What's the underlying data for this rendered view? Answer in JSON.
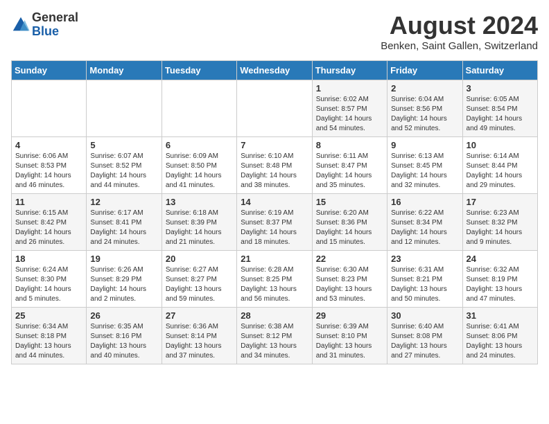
{
  "logo": {
    "general": "General",
    "blue": "Blue"
  },
  "title": {
    "month_year": "August 2024",
    "location": "Benken, Saint Gallen, Switzerland"
  },
  "weekdays": [
    "Sunday",
    "Monday",
    "Tuesday",
    "Wednesday",
    "Thursday",
    "Friday",
    "Saturday"
  ],
  "weeks": [
    [
      {
        "day": "",
        "detail": ""
      },
      {
        "day": "",
        "detail": ""
      },
      {
        "day": "",
        "detail": ""
      },
      {
        "day": "",
        "detail": ""
      },
      {
        "day": "1",
        "detail": "Sunrise: 6:02 AM\nSunset: 8:57 PM\nDaylight: 14 hours\nand 54 minutes."
      },
      {
        "day": "2",
        "detail": "Sunrise: 6:04 AM\nSunset: 8:56 PM\nDaylight: 14 hours\nand 52 minutes."
      },
      {
        "day": "3",
        "detail": "Sunrise: 6:05 AM\nSunset: 8:54 PM\nDaylight: 14 hours\nand 49 minutes."
      }
    ],
    [
      {
        "day": "4",
        "detail": "Sunrise: 6:06 AM\nSunset: 8:53 PM\nDaylight: 14 hours\nand 46 minutes."
      },
      {
        "day": "5",
        "detail": "Sunrise: 6:07 AM\nSunset: 8:52 PM\nDaylight: 14 hours\nand 44 minutes."
      },
      {
        "day": "6",
        "detail": "Sunrise: 6:09 AM\nSunset: 8:50 PM\nDaylight: 14 hours\nand 41 minutes."
      },
      {
        "day": "7",
        "detail": "Sunrise: 6:10 AM\nSunset: 8:48 PM\nDaylight: 14 hours\nand 38 minutes."
      },
      {
        "day": "8",
        "detail": "Sunrise: 6:11 AM\nSunset: 8:47 PM\nDaylight: 14 hours\nand 35 minutes."
      },
      {
        "day": "9",
        "detail": "Sunrise: 6:13 AM\nSunset: 8:45 PM\nDaylight: 14 hours\nand 32 minutes."
      },
      {
        "day": "10",
        "detail": "Sunrise: 6:14 AM\nSunset: 8:44 PM\nDaylight: 14 hours\nand 29 minutes."
      }
    ],
    [
      {
        "day": "11",
        "detail": "Sunrise: 6:15 AM\nSunset: 8:42 PM\nDaylight: 14 hours\nand 26 minutes."
      },
      {
        "day": "12",
        "detail": "Sunrise: 6:17 AM\nSunset: 8:41 PM\nDaylight: 14 hours\nand 24 minutes."
      },
      {
        "day": "13",
        "detail": "Sunrise: 6:18 AM\nSunset: 8:39 PM\nDaylight: 14 hours\nand 21 minutes."
      },
      {
        "day": "14",
        "detail": "Sunrise: 6:19 AM\nSunset: 8:37 PM\nDaylight: 14 hours\nand 18 minutes."
      },
      {
        "day": "15",
        "detail": "Sunrise: 6:20 AM\nSunset: 8:36 PM\nDaylight: 14 hours\nand 15 minutes."
      },
      {
        "day": "16",
        "detail": "Sunrise: 6:22 AM\nSunset: 8:34 PM\nDaylight: 14 hours\nand 12 minutes."
      },
      {
        "day": "17",
        "detail": "Sunrise: 6:23 AM\nSunset: 8:32 PM\nDaylight: 14 hours\nand 9 minutes."
      }
    ],
    [
      {
        "day": "18",
        "detail": "Sunrise: 6:24 AM\nSunset: 8:30 PM\nDaylight: 14 hours\nand 5 minutes."
      },
      {
        "day": "19",
        "detail": "Sunrise: 6:26 AM\nSunset: 8:29 PM\nDaylight: 14 hours\nand 2 minutes."
      },
      {
        "day": "20",
        "detail": "Sunrise: 6:27 AM\nSunset: 8:27 PM\nDaylight: 13 hours\nand 59 minutes."
      },
      {
        "day": "21",
        "detail": "Sunrise: 6:28 AM\nSunset: 8:25 PM\nDaylight: 13 hours\nand 56 minutes."
      },
      {
        "day": "22",
        "detail": "Sunrise: 6:30 AM\nSunset: 8:23 PM\nDaylight: 13 hours\nand 53 minutes."
      },
      {
        "day": "23",
        "detail": "Sunrise: 6:31 AM\nSunset: 8:21 PM\nDaylight: 13 hours\nand 50 minutes."
      },
      {
        "day": "24",
        "detail": "Sunrise: 6:32 AM\nSunset: 8:19 PM\nDaylight: 13 hours\nand 47 minutes."
      }
    ],
    [
      {
        "day": "25",
        "detail": "Sunrise: 6:34 AM\nSunset: 8:18 PM\nDaylight: 13 hours\nand 44 minutes."
      },
      {
        "day": "26",
        "detail": "Sunrise: 6:35 AM\nSunset: 8:16 PM\nDaylight: 13 hours\nand 40 minutes."
      },
      {
        "day": "27",
        "detail": "Sunrise: 6:36 AM\nSunset: 8:14 PM\nDaylight: 13 hours\nand 37 minutes."
      },
      {
        "day": "28",
        "detail": "Sunrise: 6:38 AM\nSunset: 8:12 PM\nDaylight: 13 hours\nand 34 minutes."
      },
      {
        "day": "29",
        "detail": "Sunrise: 6:39 AM\nSunset: 8:10 PM\nDaylight: 13 hours\nand 31 minutes."
      },
      {
        "day": "30",
        "detail": "Sunrise: 6:40 AM\nSunset: 8:08 PM\nDaylight: 13 hours\nand 27 minutes."
      },
      {
        "day": "31",
        "detail": "Sunrise: 6:41 AM\nSunset: 8:06 PM\nDaylight: 13 hours\nand 24 minutes."
      }
    ]
  ]
}
